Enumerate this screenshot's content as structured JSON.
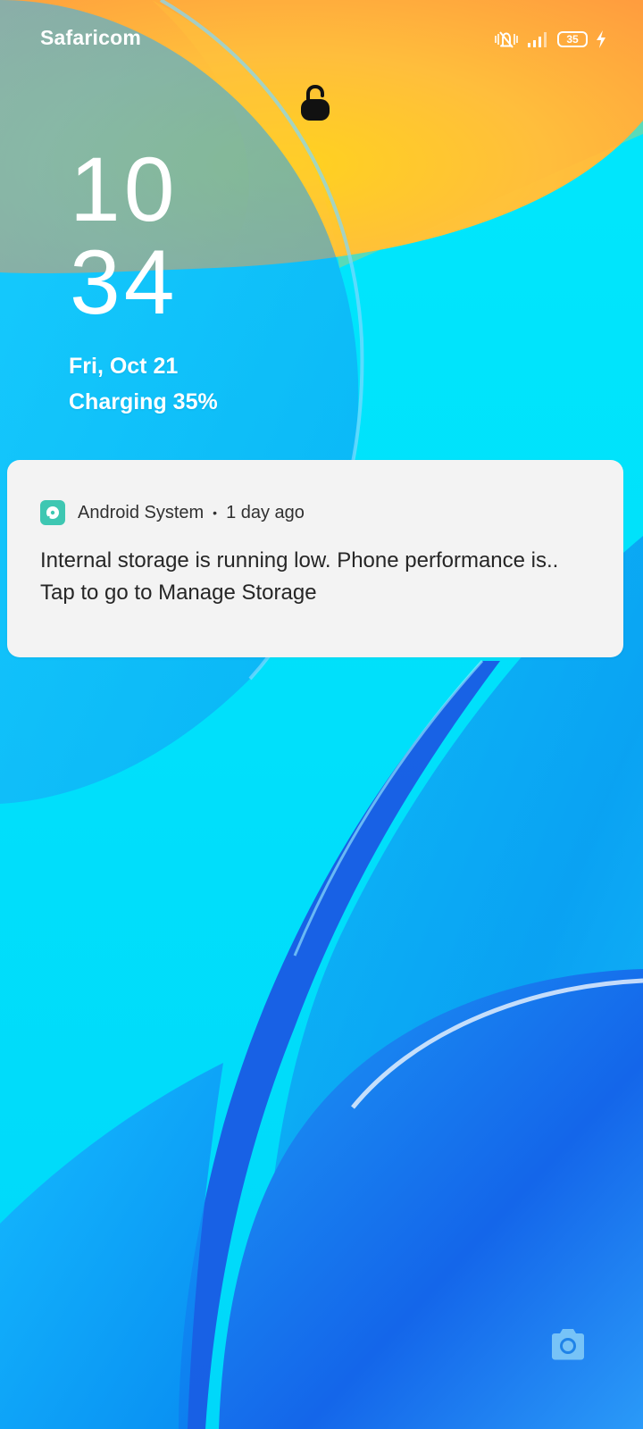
{
  "status_bar": {
    "carrier": "Safaricom",
    "battery_level": "35",
    "icons": [
      "vibrate-icon",
      "signal-icon",
      "battery-icon",
      "charging-bolt-icon"
    ]
  },
  "lockscreen": {
    "lock_icon": "lock-open-icon",
    "clock": {
      "hours": "10",
      "minutes": "34"
    },
    "date": "Fri, Oct 21",
    "charging": "Charging 35%"
  },
  "notification": {
    "app_icon": "storage-icon",
    "app_name": "Android System",
    "separator": "•",
    "time": "1 day ago",
    "line1": "Internal storage is running low. Phone performance is..",
    "line2": "Tap to go to Manage Storage"
  },
  "shortcuts": {
    "camera_icon": "camera-icon"
  },
  "colors": {
    "wallpaper_cyan": "#00e5fb",
    "wallpaper_blue": "#1a6ff0",
    "wallpaper_orange": "#ffb238",
    "notification_bg": "#f3f3f3",
    "app_icon_bg": "#3ec7b2"
  }
}
